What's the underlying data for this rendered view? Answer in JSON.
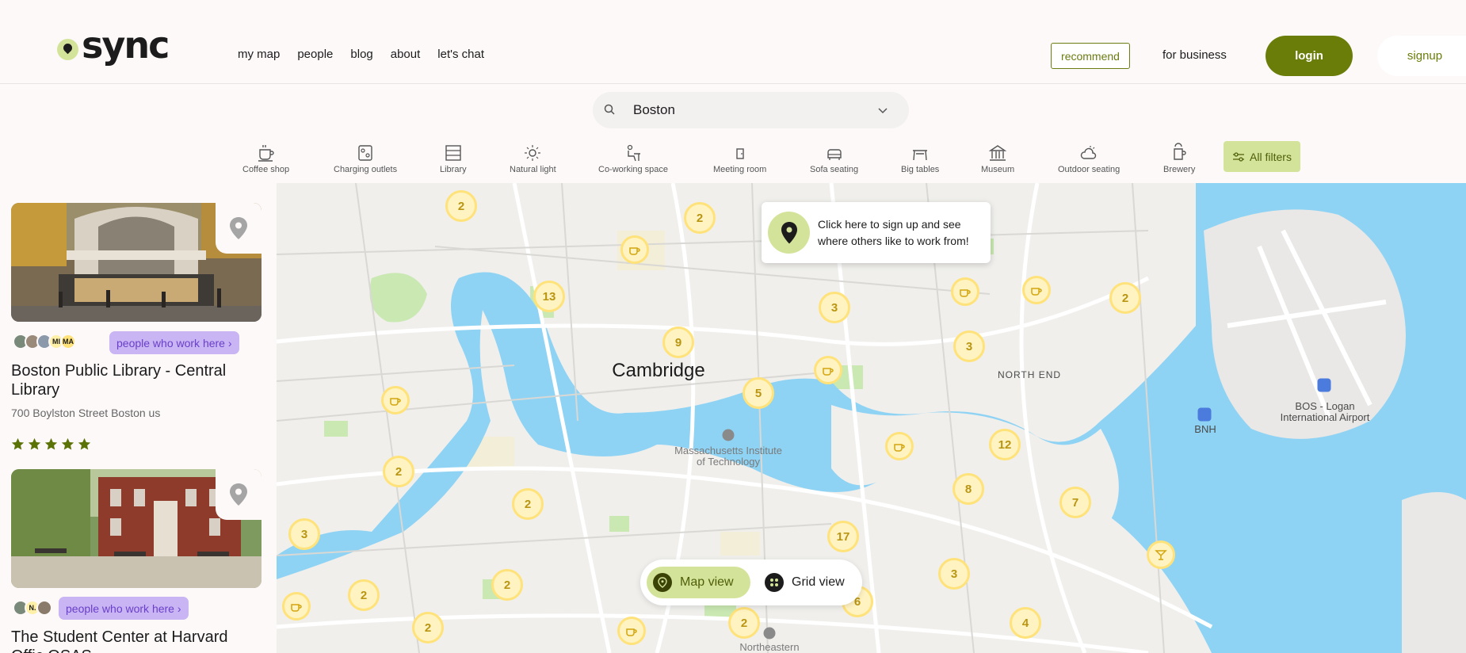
{
  "header": {
    "logo_text": "sync",
    "nav": [
      "my map",
      "people",
      "blog",
      "about",
      "let's chat"
    ],
    "recommend_label": "recommend",
    "business_label": "for business",
    "login_label": "login",
    "signup_label": "signup"
  },
  "search": {
    "value": "Boston"
  },
  "filters": {
    "items": [
      "Coffee shop",
      "Charging outlets",
      "Library",
      "Natural light",
      "Co-working space",
      "Meeting room",
      "Sofa seating",
      "Big tables",
      "Museum",
      "Outdoor seating",
      "Brewery"
    ],
    "all_filters_label": "All filters"
  },
  "sidebar": {
    "cards": [
      {
        "initials": [
          "MI",
          "MA"
        ],
        "people_label": "people who work here ›",
        "name": "Boston Public Library - Central Library",
        "address": "700 Boylston Street Boston us",
        "rating": 5
      },
      {
        "initials": [
          "N."
        ],
        "people_label": "people who work here ›",
        "name": "The Student Center at Harvard Offic OSAS",
        "address": "",
        "rating": 0
      }
    ]
  },
  "map": {
    "clusters": [
      "2",
      "2",
      "13",
      "3",
      "9",
      "5",
      "3",
      "2",
      "12",
      "8",
      "7",
      "17",
      "2",
      "2",
      "3",
      "2",
      "2",
      "3",
      "6",
      "2",
      "4",
      "2"
    ],
    "labels": {
      "cambridge": "Cambridge",
      "north_end": "NORTH END",
      "mit": "Massachusetts Institute of Technology",
      "bnh": "BNH",
      "airport": "BOS - Logan International Airport",
      "northeastern": "Northeastern"
    },
    "tooltip": "Click here to sign up and see where others like to work from!",
    "view_toggle": {
      "map_label": "Map view",
      "grid_label": "Grid view"
    }
  },
  "colors": {
    "brand_green": "#6a7d09",
    "accent_lime": "#d3e49a",
    "pill_purple": "#c9b4f4",
    "marker_yellow": "#ffe27a",
    "water": "#8fd3f4",
    "star": "#5b7207"
  }
}
